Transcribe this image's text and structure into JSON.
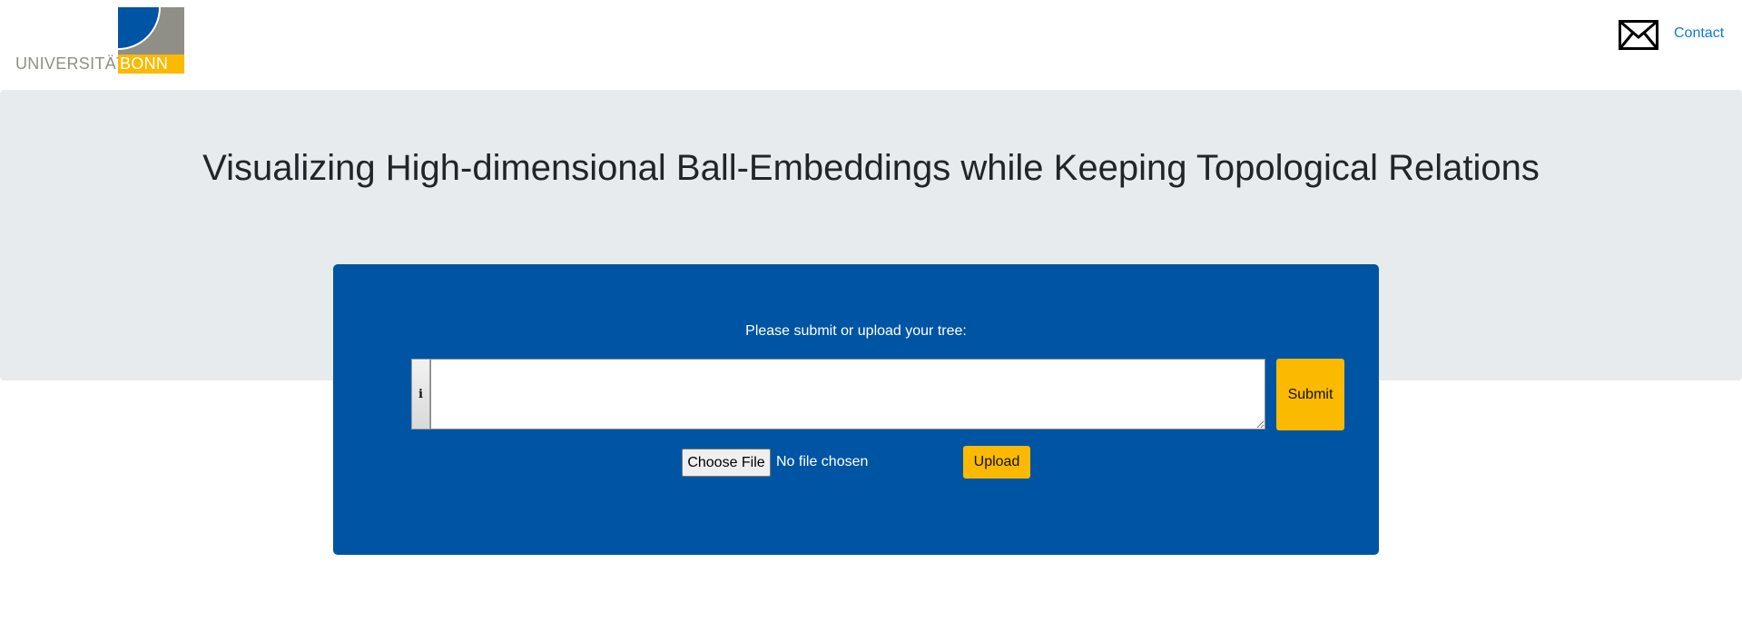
{
  "header": {
    "logo": {
      "text_left": "UNIVERSITÄT",
      "text_right": "BONN",
      "colors": {
        "blue": "#0054a4",
        "gray": "#8f8f87",
        "yellow": "#fbb900"
      }
    },
    "mail_icon": "envelope-icon",
    "contact_label": "Contact"
  },
  "hero": {
    "title": "Visualizing High-dimensional Ball-Embeddings while Keeping Topological Relations"
  },
  "form": {
    "prompt": "Please submit or upload your tree:",
    "info_icon": "info-icon",
    "info_glyph": "i",
    "tree_input_value": "",
    "submit_label": "Submit",
    "choose_file_label": "Choose File",
    "file_status": "No file chosen",
    "upload_label": "Upload"
  },
  "colors": {
    "panel": "#0054a4",
    "accent": "#fbb900",
    "hero_bg": "#e8ebee",
    "link": "#0d7bd6"
  }
}
